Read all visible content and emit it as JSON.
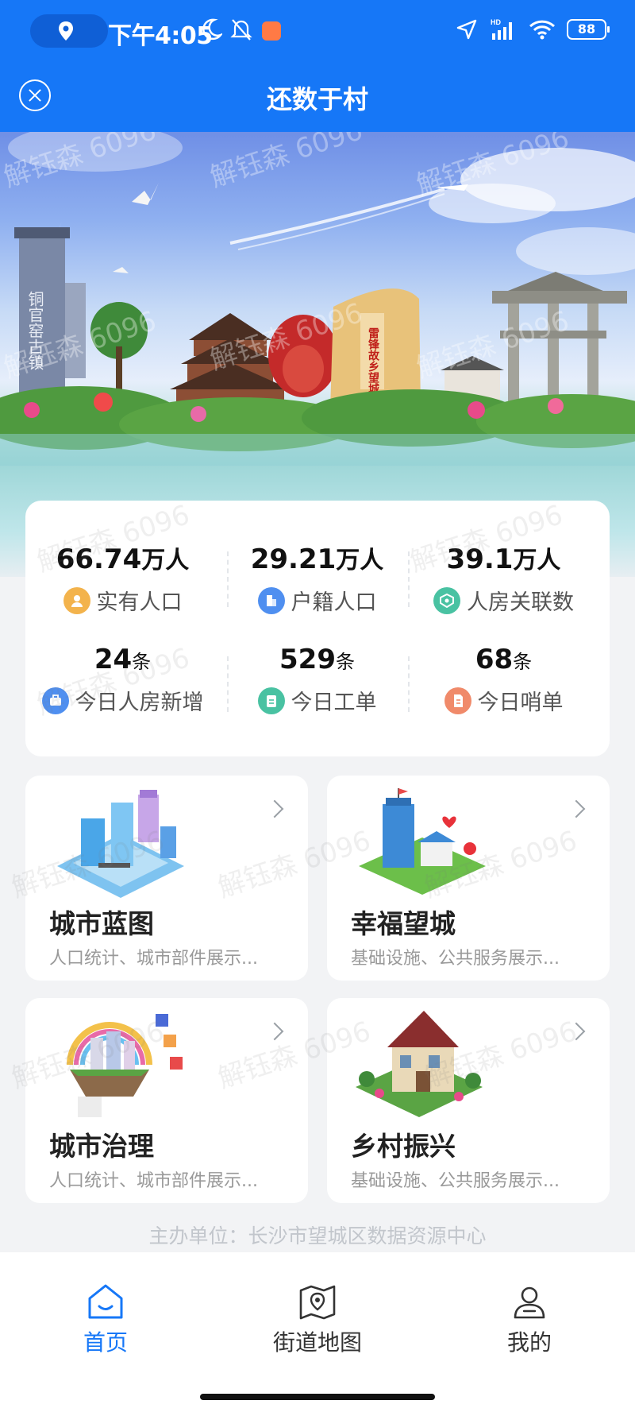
{
  "status_bar": {
    "time": "下午4:05",
    "battery": "88",
    "network": "HD"
  },
  "header": {
    "title": "还数于村"
  },
  "watermark": "解钰森 6096",
  "stats": [
    {
      "value": "66.74",
      "unit": "万人",
      "label": "实有人口",
      "icon": "person-icon",
      "color": "#f3b34c"
    },
    {
      "value": "29.21",
      "unit": "万人",
      "label": "户籍人口",
      "icon": "building-icon",
      "color": "#4f8ff0"
    },
    {
      "value": "39.1",
      "unit": "万人",
      "label": "人房关联数",
      "icon": "house-link-icon",
      "color": "#49c2a2"
    },
    {
      "value": "24",
      "unit": "条",
      "label": "今日人房新增",
      "icon": "briefcase-icon",
      "color": "#4f8ff0"
    },
    {
      "value": "529",
      "unit": "条",
      "label": "今日工单",
      "icon": "clipboard-icon",
      "color": "#49c2a2"
    },
    {
      "value": "68",
      "unit": "条",
      "label": "今日哨单",
      "icon": "document-icon",
      "color": "#f08a6a"
    }
  ],
  "features": [
    {
      "title": "城市蓝图",
      "desc": "人口统计、城市部件展示..."
    },
    {
      "title": "幸福望城",
      "desc": "基础设施、公共服务展示..."
    },
    {
      "title": "城市治理",
      "desc": "人口统计、城市部件展示..."
    },
    {
      "title": "乡村振兴",
      "desc": "基础设施、公共服务展示..."
    }
  ],
  "sponsor": "主办单位：长沙市望城区数据资源中心",
  "nav": [
    {
      "label": "首页",
      "icon": "home-icon",
      "active": true
    },
    {
      "label": "街道地图",
      "icon": "map-icon",
      "active": false
    },
    {
      "label": "我的",
      "icon": "profile-icon",
      "active": false
    }
  ],
  "colors": {
    "primary": "#1677f7"
  }
}
